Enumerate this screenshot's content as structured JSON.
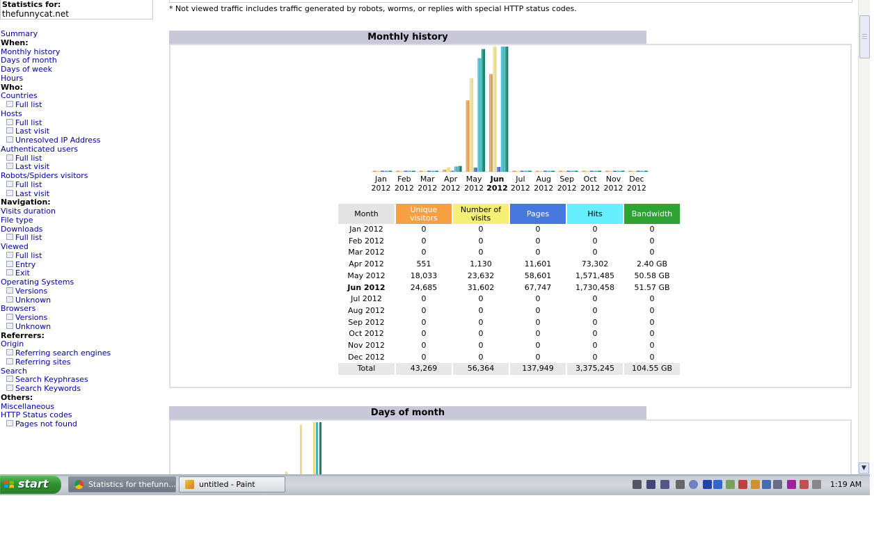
{
  "sidebar": {
    "stats_label": "Statistics for:",
    "site_name": "thefunnycat.net",
    "menu": [
      {
        "type": "link",
        "label": "Summary"
      },
      {
        "type": "head",
        "label": "When:"
      },
      {
        "type": "link",
        "label": "Monthly history"
      },
      {
        "type": "link",
        "label": "Days of month"
      },
      {
        "type": "link",
        "label": "Days of week"
      },
      {
        "type": "link",
        "label": "Hours"
      },
      {
        "type": "head",
        "label": "Who:"
      },
      {
        "type": "link",
        "label": "Countries"
      },
      {
        "type": "sub",
        "label": "Full list"
      },
      {
        "type": "link",
        "label": "Hosts"
      },
      {
        "type": "sub",
        "label": "Full list"
      },
      {
        "type": "sub",
        "label": "Last visit"
      },
      {
        "type": "sub",
        "label": "Unresolved IP Address"
      },
      {
        "type": "link",
        "label": "Authenticated users"
      },
      {
        "type": "sub",
        "label": "Full list"
      },
      {
        "type": "sub",
        "label": "Last visit"
      },
      {
        "type": "link",
        "label": "Robots/Spiders visitors"
      },
      {
        "type": "sub",
        "label": "Full list"
      },
      {
        "type": "sub",
        "label": "Last visit"
      },
      {
        "type": "head",
        "label": "Navigation:"
      },
      {
        "type": "link",
        "label": "Visits duration"
      },
      {
        "type": "link",
        "label": "File type"
      },
      {
        "type": "link",
        "label": "Downloads"
      },
      {
        "type": "sub",
        "label": "Full list"
      },
      {
        "type": "link",
        "label": "Viewed"
      },
      {
        "type": "sub",
        "label": "Full list"
      },
      {
        "type": "sub",
        "label": "Entry"
      },
      {
        "type": "sub",
        "label": "Exit"
      },
      {
        "type": "link",
        "label": "Operating Systems"
      },
      {
        "type": "sub",
        "label": "Versions"
      },
      {
        "type": "sub",
        "label": "Unknown"
      },
      {
        "type": "link",
        "label": "Browsers"
      },
      {
        "type": "sub",
        "label": "Versions"
      },
      {
        "type": "sub",
        "label": "Unknown"
      },
      {
        "type": "head",
        "label": "Referrers:"
      },
      {
        "type": "link",
        "label": "Origin"
      },
      {
        "type": "sub",
        "label": "Referring search engines"
      },
      {
        "type": "sub",
        "label": "Referring sites"
      },
      {
        "type": "link",
        "label": "Search"
      },
      {
        "type": "sub",
        "label": "Search Keyphrases"
      },
      {
        "type": "sub",
        "label": "Search Keywords"
      },
      {
        "type": "head",
        "label": "Others:"
      },
      {
        "type": "link",
        "label": "Miscellaneous"
      },
      {
        "type": "link",
        "label": "HTTP Status codes"
      },
      {
        "type": "sub",
        "label": "Pages not found"
      }
    ]
  },
  "main": {
    "note": "* Not viewed traffic includes traffic generated by robots, worms, or replies with special HTTP status codes.",
    "monthly_title": "Monthly history",
    "days_title": "Days of month"
  },
  "colors": {
    "unique": "#f7a043",
    "visits": "#f5f075",
    "pages": "#4778dd",
    "hits": "#66f0ff",
    "bandwidth": "#2ea232",
    "unique_bar": "#e19d54",
    "visits_bar": "#e8dc8a",
    "pages_bar": "#4d66c8",
    "hits_bar": "#3fb7c8",
    "bandwidth_bar": "#14846e"
  },
  "table": {
    "headers": [
      "Month",
      "Unique visitors",
      "Number of visits",
      "Pages",
      "Hits",
      "Bandwidth"
    ],
    "rows": [
      [
        "Jan 2012",
        "0",
        "0",
        "0",
        "0",
        "0"
      ],
      [
        "Feb 2012",
        "0",
        "0",
        "0",
        "0",
        "0"
      ],
      [
        "Mar 2012",
        "0",
        "0",
        "0",
        "0",
        "0"
      ],
      [
        "Apr 2012",
        "551",
        "1,130",
        "11,601",
        "73,302",
        "2.40 GB"
      ],
      [
        "May 2012",
        "18,033",
        "23,632",
        "58,601",
        "1,571,485",
        "50.58 GB"
      ],
      [
        "Jun 2012",
        "24,685",
        "31,602",
        "67,747",
        "1,730,458",
        "51.57 GB"
      ],
      [
        "Jul 2012",
        "0",
        "0",
        "0",
        "0",
        "0"
      ],
      [
        "Aug 2012",
        "0",
        "0",
        "0",
        "0",
        "0"
      ],
      [
        "Sep 2012",
        "0",
        "0",
        "0",
        "0",
        "0"
      ],
      [
        "Oct 2012",
        "0",
        "0",
        "0",
        "0",
        "0"
      ],
      [
        "Nov 2012",
        "0",
        "0",
        "0",
        "0",
        "0"
      ],
      [
        "Dec 2012",
        "0",
        "0",
        "0",
        "0",
        "0"
      ]
    ],
    "current_row": 5,
    "total": [
      "Total",
      "43,269",
      "56,364",
      "137,949",
      "3,375,245",
      "104.55 GB"
    ]
  },
  "chart_data": {
    "type": "bar",
    "categories": [
      "Jan 2012",
      "Feb 2012",
      "Mar 2012",
      "Apr 2012",
      "May 2012",
      "Jun 2012",
      "Jul 2012",
      "Aug 2012",
      "Sep 2012",
      "Oct 2012",
      "Nov 2012",
      "Dec 2012"
    ],
    "x_month_labels": [
      "Jan",
      "Feb",
      "Mar",
      "Apr",
      "May",
      "Jun",
      "Jul",
      "Aug",
      "Sep",
      "Oct",
      "Nov",
      "Dec"
    ],
    "x_year_label": "2012",
    "current_index": 5,
    "series": [
      {
        "name": "Unique visitors",
        "values": [
          0,
          0,
          0,
          551,
          18033,
          24685,
          0,
          0,
          0,
          0,
          0,
          0
        ]
      },
      {
        "name": "Number of visits",
        "values": [
          0,
          0,
          0,
          1130,
          23632,
          31602,
          0,
          0,
          0,
          0,
          0,
          0
        ]
      },
      {
        "name": "Pages",
        "values": [
          0,
          0,
          0,
          11601,
          58601,
          67747,
          0,
          0,
          0,
          0,
          0,
          0
        ]
      },
      {
        "name": "Hits",
        "values": [
          0,
          0,
          0,
          73302,
          1571485,
          1730458,
          0,
          0,
          0,
          0,
          0,
          0
        ]
      },
      {
        "name": "Bandwidth",
        "values": [
          0,
          0,
          0,
          2.4,
          50.58,
          51.57,
          0,
          0,
          0,
          0,
          0,
          0
        ]
      }
    ],
    "scale_groups": [
      [
        0,
        1
      ],
      [
        2,
        3
      ],
      [
        4
      ]
    ],
    "title": "Monthly history"
  },
  "days_chart": {
    "series_colors": [
      "#e8dc8a",
      "#e8dc8a",
      "#e8dc8a",
      "#3fb7c8",
      "#14846e"
    ],
    "values": [
      0.05,
      0.95,
      1.0,
      1.0,
      1.0
    ]
  },
  "taskbar": {
    "start_label": "start",
    "tasks": [
      {
        "label": "Statistics for thefunn...",
        "active": true
      },
      {
        "label": "untitled - Paint",
        "active": false
      }
    ],
    "clock": "1:19 AM"
  }
}
